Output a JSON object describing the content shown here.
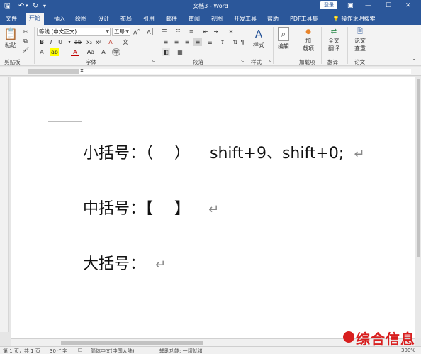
{
  "titlebar": {
    "doc_title": "文档3 - Word",
    "login_label": "登录",
    "save_icon": "save-icon",
    "undo_icon": "undo-icon",
    "redo_icon": "redo-icon",
    "customize_icon": "customize-icon"
  },
  "tabs": {
    "file": "文件",
    "home": "开始",
    "insert": "插入",
    "draw": "绘图",
    "design": "设计",
    "layout": "布局",
    "references": "引用",
    "mailings": "邮件",
    "review": "审阅",
    "view": "视图",
    "developer": "开发工具",
    "help": "帮助",
    "pdf": "PDF工具集",
    "tellme": "操作说明搜索"
  },
  "ribbon": {
    "clipboard": {
      "paste_label": "粘贴",
      "group_label": "剪贴板"
    },
    "font": {
      "font_name": "等线 (中文正文)",
      "font_size": "五号",
      "group_label": "字体"
    },
    "paragraph": {
      "group_label": "段落"
    },
    "styles": {
      "styles_label": "样式",
      "group_label": "样式"
    },
    "editing": {
      "editing_label": "编辑"
    },
    "addins": {
      "label_line1": "加",
      "label_line2": "载项",
      "group_label": "加载项"
    },
    "translate": {
      "label_line1": "全文",
      "label_line2": "翻译",
      "group_label": "翻译"
    },
    "paper": {
      "label_line1": "论文",
      "label_line2": "查重",
      "group_label": "论文"
    }
  },
  "document": {
    "line1_label": "小括号：（",
    "line1_close": "）",
    "line1_shortcut": "shift+9、shift+0;",
    "line2_label": "中括号：【",
    "line2_close": "】",
    "line3_label": "大括号：",
    "para_mark": "↵"
  },
  "status": {
    "page": "第 1 页，共 1 页",
    "words": "30 个字",
    "language": "简体中文(中国大陆)",
    "accessibility": "辅助功能: 一切就绪",
    "zoom": "300%"
  },
  "watermark": {
    "text": "综合信息"
  }
}
